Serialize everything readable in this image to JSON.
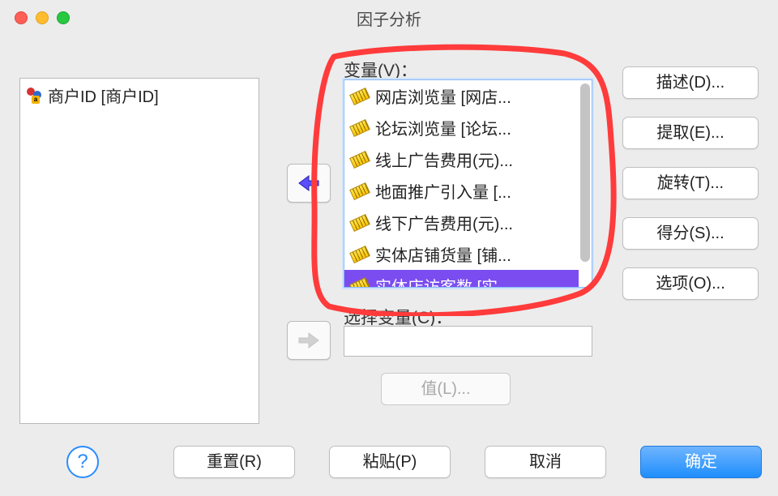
{
  "window": {
    "title": "因子分析"
  },
  "source": {
    "items": [
      {
        "label": "商户ID [商户ID]",
        "type": "nominal"
      }
    ]
  },
  "variables": {
    "label": "变量(V)：",
    "items": [
      {
        "label": "网店浏览量 [网店...",
        "selected": false
      },
      {
        "label": "论坛浏览量 [论坛...",
        "selected": false
      },
      {
        "label": "线上广告费用(元)...",
        "selected": false
      },
      {
        "label": "地面推广引入量 [...",
        "selected": false
      },
      {
        "label": "线下广告费用(元)...",
        "selected": false
      },
      {
        "label": "实体店铺货量 [铺...",
        "selected": false
      },
      {
        "label": "实体店访客数 [实...",
        "selected": true
      }
    ]
  },
  "selection": {
    "label": "选择变量(C)：",
    "value": ""
  },
  "side_buttons": {
    "describe": "描述(D)...",
    "extract": "提取(E)...",
    "rotate": "旋转(T)...",
    "scores": "得分(S)...",
    "options": "选项(O)..."
  },
  "buttons": {
    "value": "值(L)...",
    "reset": "重置(R)",
    "paste": "粘贴(P)",
    "cancel": "取消",
    "ok": "确定"
  }
}
